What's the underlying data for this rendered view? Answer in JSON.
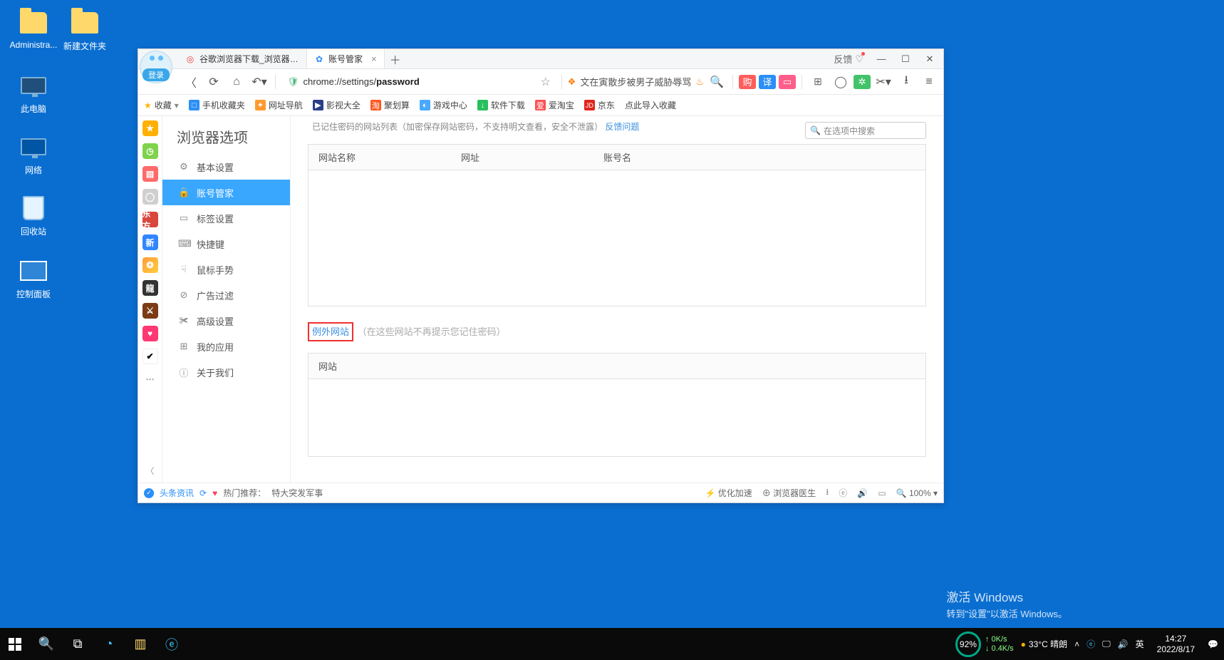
{
  "desktop": {
    "icons": {
      "admin": "Administra...",
      "newfolder": "新建文件夹",
      "pc": "此电脑",
      "net": "网络",
      "bin": "回收站",
      "ctrl": "控制面板"
    },
    "watermark": {
      "title": "激活 Windows",
      "sub": "转到\"设置\"以激活 Windows。"
    }
  },
  "taskbar": {
    "usage": {
      "percent": "92%",
      "up": "0K/s",
      "down": "0.4K/s"
    },
    "weather": "33°C 晴朗",
    "ime": "英",
    "time": "14:27",
    "date": "2022/8/17"
  },
  "browser": {
    "login": "登录",
    "tabs": [
      {
        "title": "谷歌浏览器下载_浏览器官网入",
        "favicon": "◎",
        "favcolor": "#ea4335",
        "active": false
      },
      {
        "title": "账号管家",
        "favicon": "✿",
        "favcolor": "#2a8ff7",
        "active": true
      }
    ],
    "titlectrl": {
      "feedback": "反馈"
    },
    "url": {
      "prefix": "chrome://settings/",
      "strong": "password"
    },
    "headline": "文在寅散步被男子威胁辱骂",
    "bookmarks": {
      "fav": "收藏",
      "items": [
        {
          "label": "手机收藏夹",
          "color": "#2a8ff7",
          "glyph": "□"
        },
        {
          "label": "网址导航",
          "color": "#ff9a2e",
          "glyph": "✦"
        },
        {
          "label": "影视大全",
          "color": "#2a3e8a",
          "glyph": "▶"
        },
        {
          "label": "聚划算",
          "color": "#ff5722",
          "glyph": "淘"
        },
        {
          "label": "游戏中心",
          "color": "#4aa9ff",
          "glyph": "◐"
        },
        {
          "label": "软件下载",
          "color": "#28c05c",
          "glyph": "↓"
        },
        {
          "label": "爱淘宝",
          "color": "#ff4f4f",
          "glyph": "爱"
        },
        {
          "label": "京东",
          "color": "#e1251b",
          "glyph": "JD"
        },
        {
          "label": "点此导入收藏",
          "color": "transparent",
          "glyph": ""
        }
      ]
    },
    "rail": {
      "new": "新"
    },
    "sidebar": {
      "title": "浏览器选项",
      "items": [
        {
          "icon": "⚙",
          "label": "基本设置"
        },
        {
          "icon": "🔒",
          "label": "账号管家"
        },
        {
          "icon": "▭",
          "label": "标签设置"
        },
        {
          "icon": "⌨",
          "label": "快捷键"
        },
        {
          "icon": "☟",
          "label": "鼠标手势"
        },
        {
          "icon": "⊘",
          "label": "广告过滤"
        },
        {
          "icon": "✀",
          "label": "高级设置"
        },
        {
          "icon": "⊞",
          "label": "我的应用"
        },
        {
          "icon": "ⓘ",
          "label": "关于我们"
        }
      ],
      "activeIndex": 1
    },
    "content": {
      "search_placeholder": "在选项中搜索",
      "cut_line": "已记住密码的网站列表（加密保存网站密码，不支持明文查看，安全不泄露）",
      "cut_link": "反馈问题",
      "table1": {
        "cols": [
          "网站名称",
          "网址",
          "账号名"
        ]
      },
      "section2": {
        "label": "例外网站",
        "note": "（在这些网站不再提示您记住密码）"
      },
      "table2": {
        "cols": [
          "网站"
        ]
      }
    },
    "statusbar": {
      "news": "头条资讯",
      "hot_prefix": "热门推荐：",
      "hot_item": "特大突发军事",
      "optimize": "优化加速",
      "doctor": "浏览器医生",
      "zoom": "100%"
    }
  }
}
